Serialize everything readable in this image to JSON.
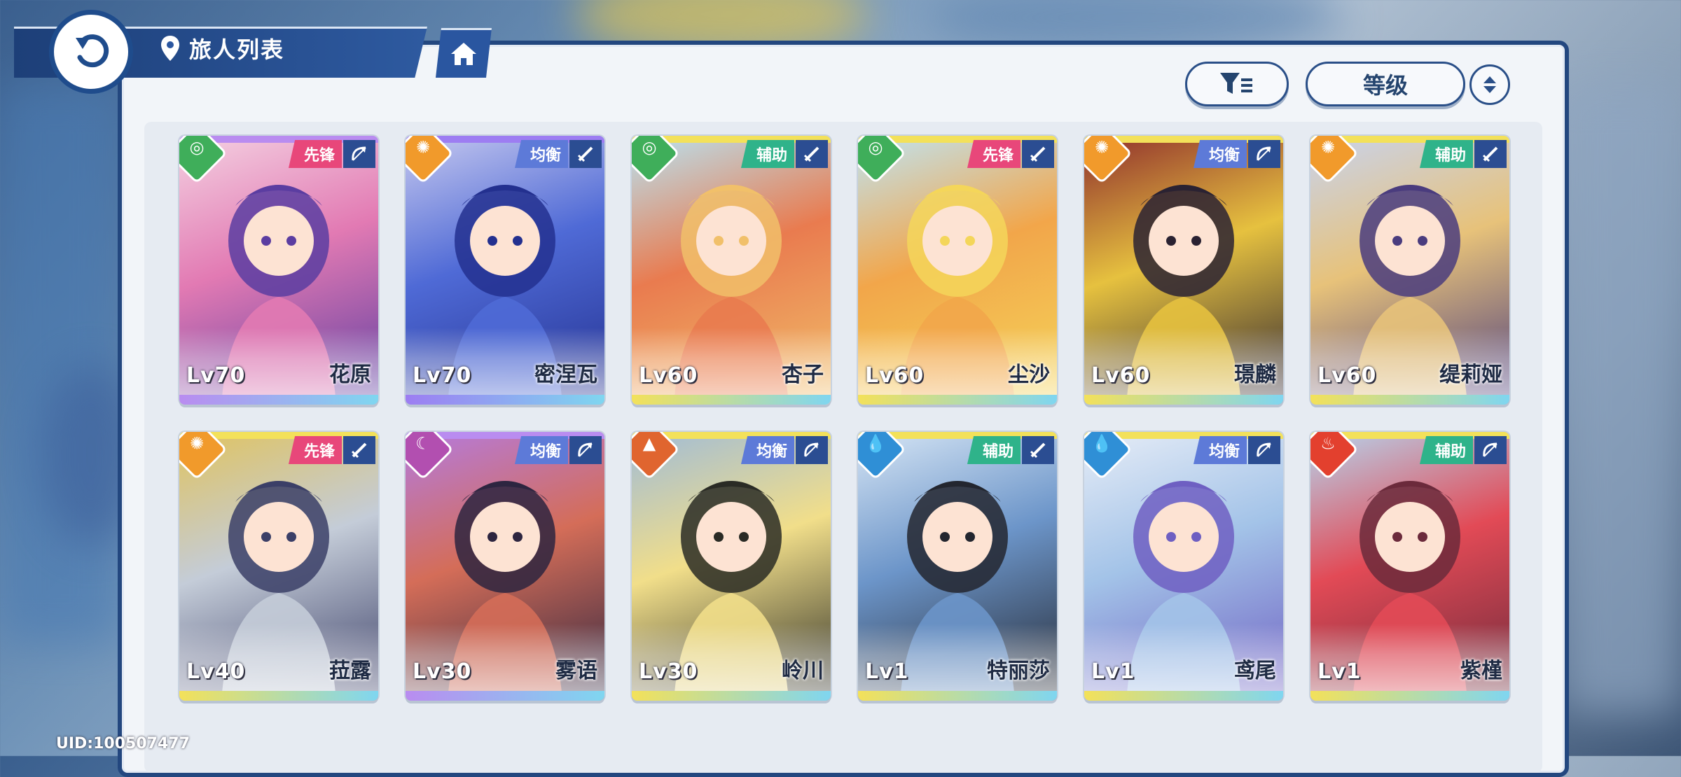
{
  "header": {
    "title": "旅人列表"
  },
  "controls": {
    "sort_label": "等级"
  },
  "footer": {
    "uid": "UID:100507477"
  },
  "colors": {
    "element_wind": "#3fae5a",
    "element_sun": "#f19a2b",
    "element_moon": "#b24fb0",
    "element_earth": "#e0652f",
    "element_water": "#2f8fd6",
    "element_fire": "#e3402e",
    "role_vanguard": "#e8477a",
    "role_balanced": "#5d7ad8",
    "role_support": "#2fb38a"
  },
  "characters": [
    {
      "level": "Lv70",
      "name": "花原",
      "role": "先锋",
      "element": "wind-icon",
      "weapon": "bow-icon"
    },
    {
      "level": "Lv70",
      "name": "密涅瓦",
      "role": "均衡",
      "element": "sun-icon",
      "weapon": "sword-icon"
    },
    {
      "level": "Lv60",
      "name": "杏子",
      "role": "辅助",
      "element": "wind-icon",
      "weapon": "sword-icon"
    },
    {
      "level": "Lv60",
      "name": "尘沙",
      "role": "先锋",
      "element": "wind-icon",
      "weapon": "sword-icon"
    },
    {
      "level": "Lv60",
      "name": "璟麟",
      "role": "均衡",
      "element": "sun-icon",
      "weapon": "bow-icon"
    },
    {
      "level": "Lv60",
      "name": "缇莉娅",
      "role": "辅助",
      "element": "sun-icon",
      "weapon": "sword-icon"
    },
    {
      "level": "Lv40",
      "name": "菈露",
      "role": "先锋",
      "element": "sun-icon",
      "weapon": "sword-icon"
    },
    {
      "level": "Lv30",
      "name": "雾语",
      "role": "均衡",
      "element": "moon-icon",
      "weapon": "bow-icon"
    },
    {
      "level": "Lv30",
      "name": "岭川",
      "role": "均衡",
      "element": "earth-icon",
      "weapon": "bow-icon"
    },
    {
      "level": "Lv1",
      "name": "特丽莎",
      "role": "辅助",
      "element": "water-icon",
      "weapon": "sword-icon"
    },
    {
      "level": "Lv1",
      "name": "鸢尾",
      "role": "均衡",
      "element": "water-icon",
      "weapon": "bow-icon"
    },
    {
      "level": "Lv1",
      "name": "紫槿",
      "role": "辅助",
      "element": "fire-icon",
      "weapon": "bow-icon"
    }
  ]
}
